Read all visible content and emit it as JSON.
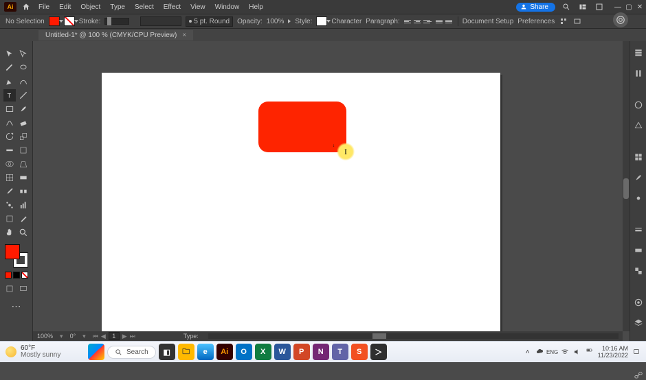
{
  "menus": {
    "file": "File",
    "edit": "Edit",
    "object": "Object",
    "type": "Type",
    "select": "Select",
    "effect": "Effect",
    "view": "View",
    "window": "Window",
    "help": "Help"
  },
  "share_label": "Share",
  "ctrl": {
    "no_selection": "No Selection",
    "stroke": "Stroke:",
    "stroke_preset": "5 pt. Round",
    "opacity": "Opacity:",
    "opacity_val": "100%",
    "style": "Style:",
    "character": "Character",
    "paragraph": "Paragraph:",
    "doc_setup": "Document Setup",
    "prefs": "Preferences"
  },
  "tab": {
    "title": "Untitled-1* @ 100 % (CMYK/CPU Preview)",
    "close": "×"
  },
  "zoombar": {
    "zoom": "100%",
    "rotate": "0°",
    "page": "1",
    "type_label": "Type:"
  },
  "weather": {
    "temp": "60°F",
    "cond": "Mostly sunny"
  },
  "search_placeholder": "Search",
  "clock": {
    "time": "10:16 AM",
    "date": "11/23/2022"
  },
  "colors": {
    "accent_red": "#fe2400",
    "canvas": "#ffffff",
    "app_bg": "#4a4a4a"
  }
}
